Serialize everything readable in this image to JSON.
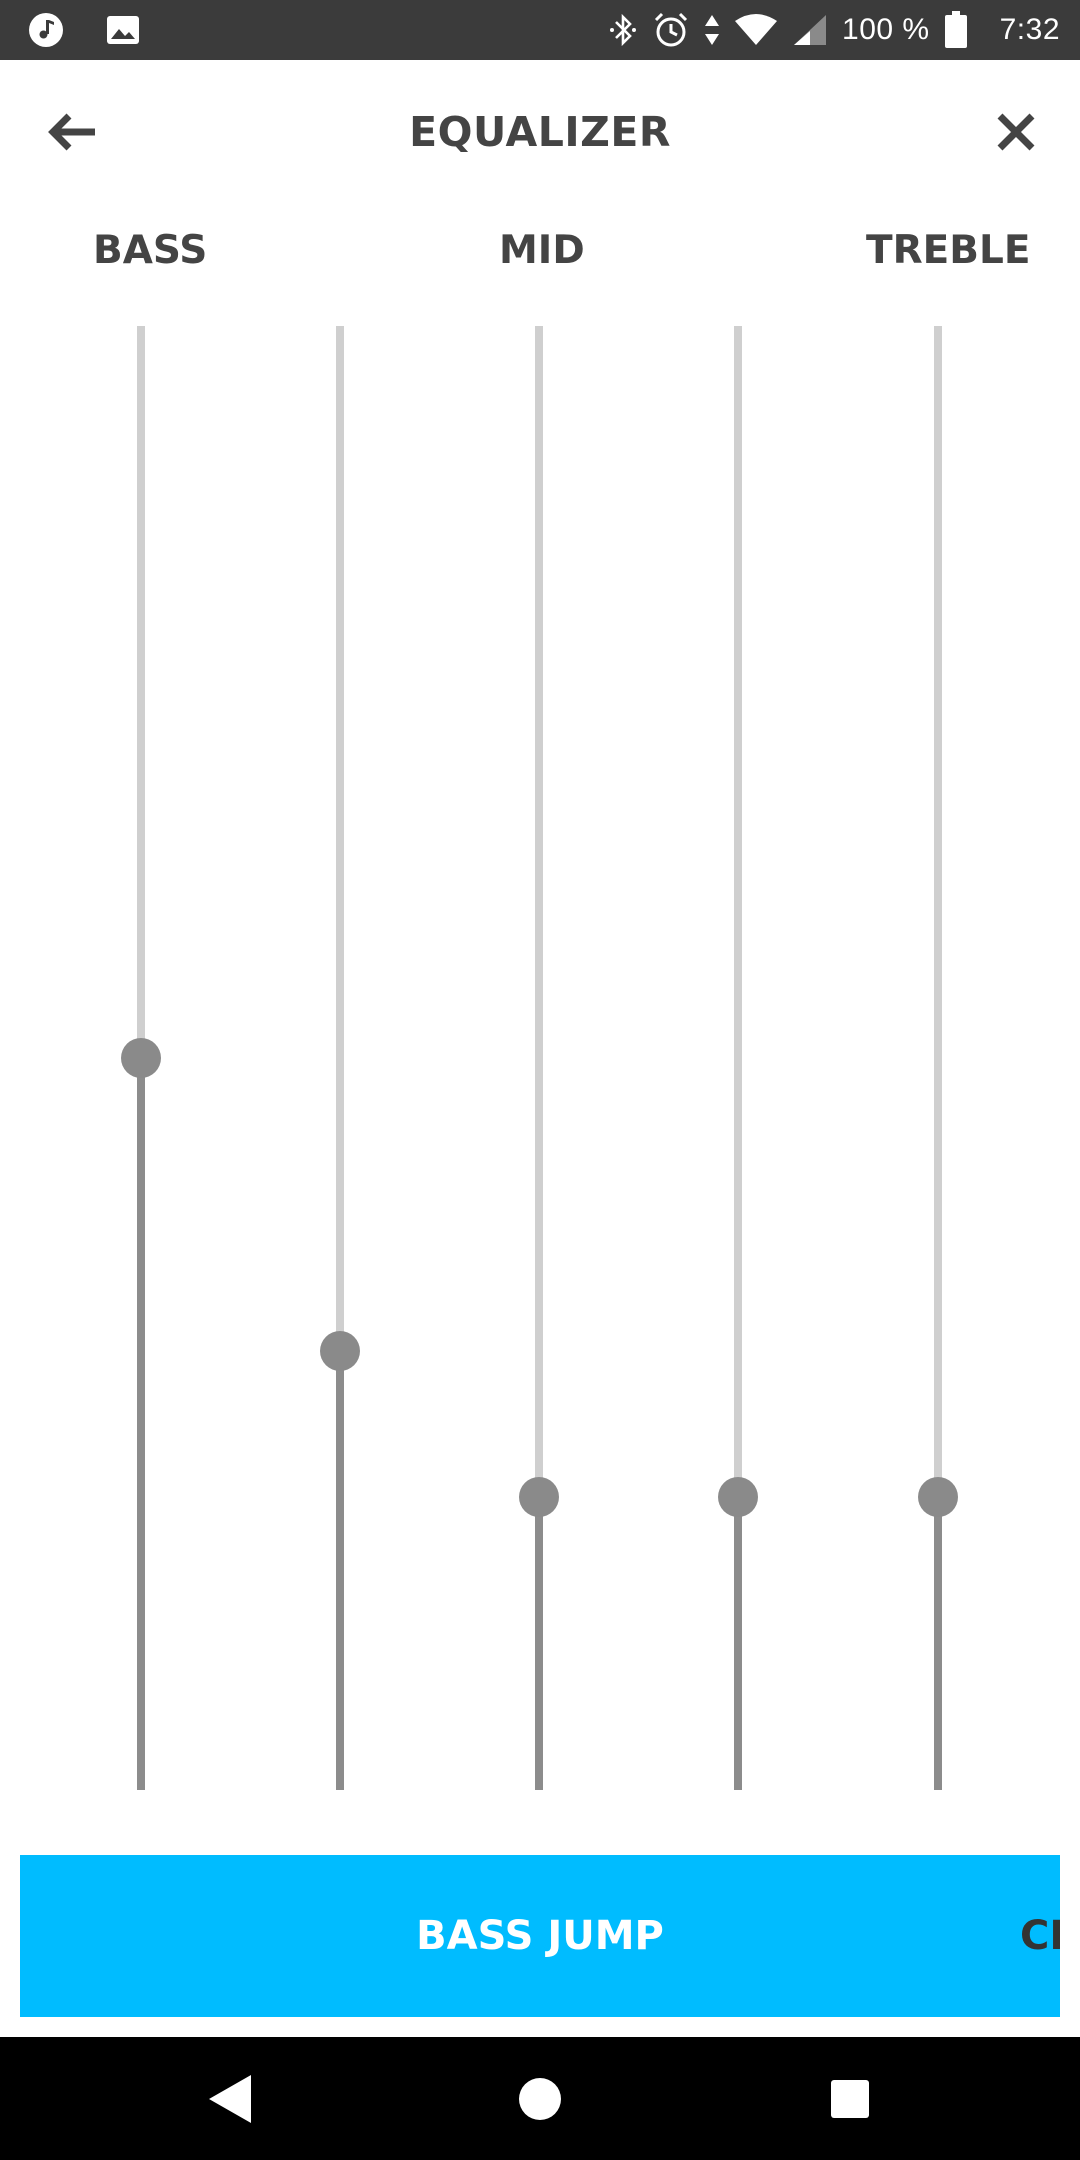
{
  "status_bar": {
    "battery_text": "100 %",
    "time": "7:32",
    "icons": [
      "music-note-icon",
      "image-icon",
      "bluetooth-icon",
      "alarm-icon",
      "data-arrows-icon",
      "wifi-icon",
      "cell-signal-icon",
      "battery-icon"
    ]
  },
  "header": {
    "title": "EQUALIZER",
    "back_icon": "arrow-left-icon",
    "close_icon": "close-icon"
  },
  "band_labels": {
    "bass": "BASS",
    "mid": "MID",
    "treble": "TREBLE"
  },
  "sliders": [
    {
      "name": "band-1",
      "level": 0.5
    },
    {
      "name": "band-2",
      "level": 0.3
    },
    {
      "name": "band-3",
      "level": 0.2
    },
    {
      "name": "band-4",
      "level": 0.2
    },
    {
      "name": "band-5",
      "level": 0.2
    }
  ],
  "presets": {
    "selected": "BASS JUMP",
    "next_partial": "CH"
  },
  "nav_bar": {
    "icons": [
      "nav-back-icon",
      "nav-home-icon",
      "nav-recents-icon"
    ]
  },
  "colors": {
    "status_bar_bg": "#3b3b3b",
    "title_text": "#444444",
    "track_inactive": "#cfcfcf",
    "track_active": "#8c8c8c",
    "thumb": "#8a8a8a",
    "accent": "#00bcff",
    "nav_bar_bg": "#000000"
  }
}
